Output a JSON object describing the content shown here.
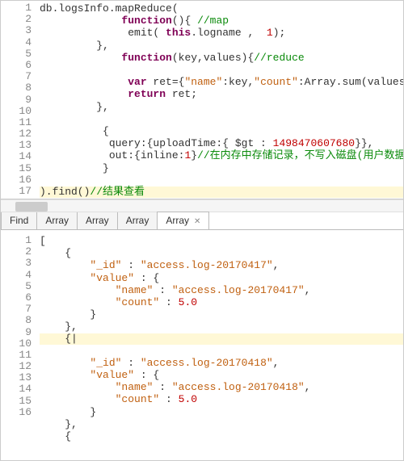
{
  "editor": {
    "lines": [
      [
        {
          "t": "db.logsInfo.mapReduce("
        }
      ],
      [
        {
          "t": "             "
        },
        {
          "t": "function",
          "c": "tok-kw"
        },
        {
          "t": "(){ "
        },
        {
          "t": "//map",
          "c": "tok-com"
        }
      ],
      [
        {
          "t": "              emit( "
        },
        {
          "t": "this",
          "c": "tok-kw"
        },
        {
          "t": ".logname ,  "
        },
        {
          "t": "1",
          "c": "tok-num"
        },
        {
          "t": ");"
        }
      ],
      [
        {
          "t": "         },"
        }
      ],
      [
        {
          "t": "             "
        },
        {
          "t": "function",
          "c": "tok-kw"
        },
        {
          "t": "(key,values){"
        },
        {
          "t": "//reduce",
          "c": "tok-com"
        }
      ],
      [
        {
          "t": ""
        }
      ],
      [
        {
          "t": "              "
        },
        {
          "t": "var",
          "c": "tok-kw"
        },
        {
          "t": " ret={"
        },
        {
          "t": "\"name\"",
          "c": "tok-str"
        },
        {
          "t": ":key,"
        },
        {
          "t": "\"count\"",
          "c": "tok-str"
        },
        {
          "t": ":Array.sum(values)};"
        }
      ],
      [
        {
          "t": "              "
        },
        {
          "t": "return",
          "c": "tok-kw"
        },
        {
          "t": " ret;"
        }
      ],
      [
        {
          "t": "         },"
        }
      ],
      [
        {
          "t": ""
        }
      ],
      [
        {
          "t": "          {"
        }
      ],
      [
        {
          "t": "           query:{uploadTime:{ $gt : "
        },
        {
          "t": "1498470607680",
          "c": "tok-num"
        },
        {
          "t": "}},"
        }
      ],
      [
        {
          "t": "           out:{inline:"
        },
        {
          "t": "1",
          "c": "tok-num"
        },
        {
          "t": "}"
        },
        {
          "t": "//在内存中存储记录，不写入磁盘(用户数据量少的场景)",
          "c": "tok-com"
        }
      ],
      [
        {
          "t": "          }"
        }
      ],
      [
        {
          "t": ""
        }
      ],
      [
        {
          "t": ").find()"
        },
        {
          "t": "//结果查看",
          "c": "tok-com"
        }
      ],
      [
        {
          "t": ""
        }
      ]
    ],
    "highlight_line": 16
  },
  "tabs": {
    "items": [
      {
        "label": "Find",
        "active": false,
        "closable": false
      },
      {
        "label": "Array",
        "active": false,
        "closable": false
      },
      {
        "label": "Array",
        "active": false,
        "closable": false
      },
      {
        "label": "Array",
        "active": false,
        "closable": false
      },
      {
        "label": "Array",
        "active": true,
        "closable": true
      }
    ],
    "close_glyph": "✕"
  },
  "result": {
    "lines": [
      [
        {
          "t": "["
        }
      ],
      [
        {
          "t": "    {"
        }
      ],
      [
        {
          "t": "        "
        },
        {
          "t": "\"_id\"",
          "c": "tok-key"
        },
        {
          "t": " : "
        },
        {
          "t": "\"access.log-20170417\"",
          "c": "tok-str"
        },
        {
          "t": ","
        }
      ],
      [
        {
          "t": "        "
        },
        {
          "t": "\"value\"",
          "c": "tok-key"
        },
        {
          "t": " : {"
        }
      ],
      [
        {
          "t": "            "
        },
        {
          "t": "\"name\"",
          "c": "tok-key"
        },
        {
          "t": " : "
        },
        {
          "t": "\"access.log-20170417\"",
          "c": "tok-str"
        },
        {
          "t": ","
        }
      ],
      [
        {
          "t": "            "
        },
        {
          "t": "\"count\"",
          "c": "tok-key"
        },
        {
          "t": " : "
        },
        {
          "t": "5.0",
          "c": "tok-num"
        }
      ],
      [
        {
          "t": "        }"
        }
      ],
      [
        {
          "t": "    },"
        }
      ],
      [
        {
          "t": "    {"
        },
        {
          "t": "|",
          "c": "caret"
        }
      ],
      [
        {
          "t": "        "
        },
        {
          "t": "\"_id\"",
          "c": "tok-key"
        },
        {
          "t": " : "
        },
        {
          "t": "\"access.log-20170418\"",
          "c": "tok-str"
        },
        {
          "t": ","
        }
      ],
      [
        {
          "t": "        "
        },
        {
          "t": "\"value\"",
          "c": "tok-key"
        },
        {
          "t": " : {"
        }
      ],
      [
        {
          "t": "            "
        },
        {
          "t": "\"name\"",
          "c": "tok-key"
        },
        {
          "t": " : "
        },
        {
          "t": "\"access.log-20170418\"",
          "c": "tok-str"
        },
        {
          "t": ","
        }
      ],
      [
        {
          "t": "            "
        },
        {
          "t": "\"count\"",
          "c": "tok-key"
        },
        {
          "t": " : "
        },
        {
          "t": "5.0",
          "c": "tok-num"
        }
      ],
      [
        {
          "t": "        }"
        }
      ],
      [
        {
          "t": "    },"
        }
      ],
      [
        {
          "t": "    {"
        }
      ]
    ],
    "highlight_line": 9
  },
  "chart_data": null
}
